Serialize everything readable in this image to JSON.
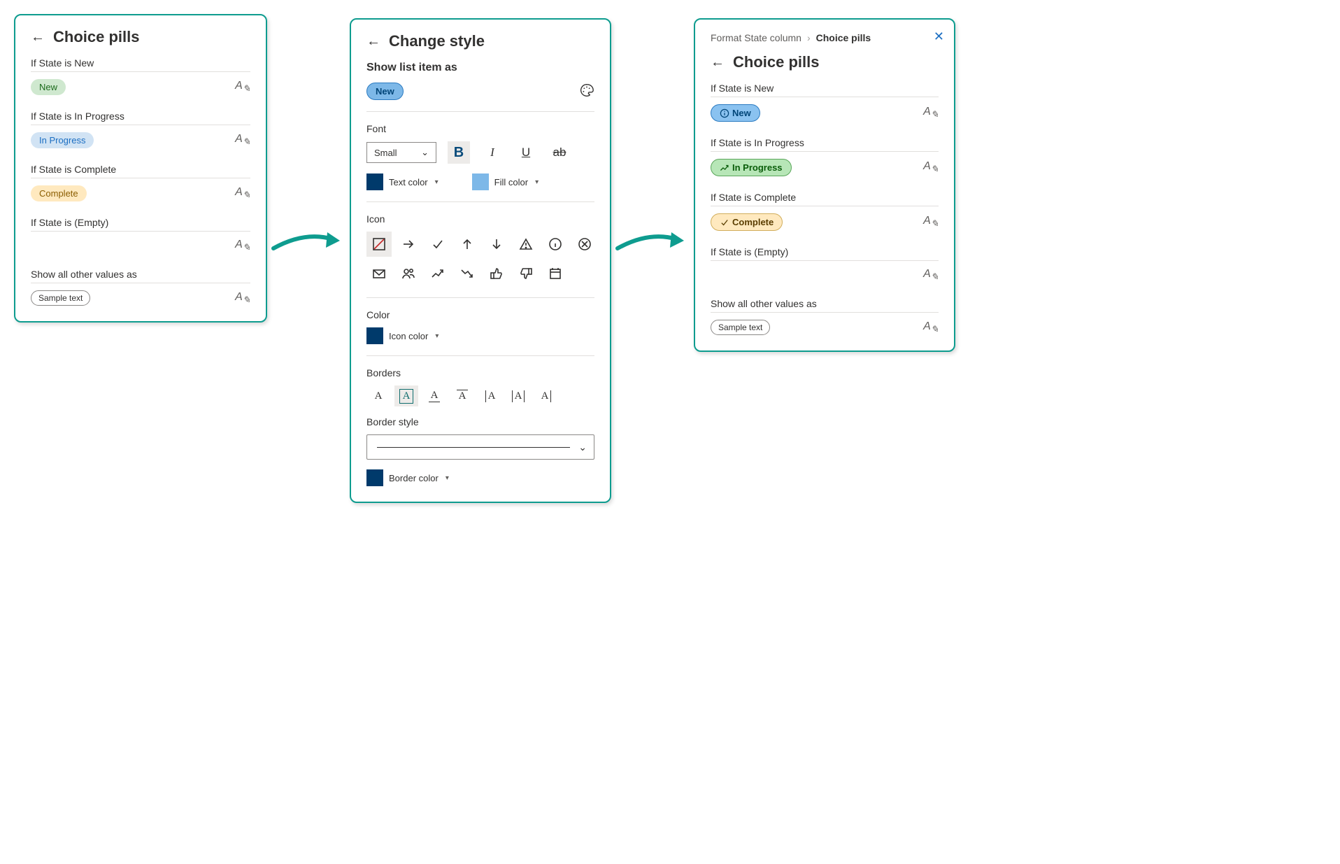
{
  "panel1": {
    "title": "Choice pills",
    "rules": [
      {
        "label": "If State is New",
        "pill": "New",
        "pill_class": "pill-green-light"
      },
      {
        "label": "If State is In Progress",
        "pill": "In Progress",
        "pill_class": "pill-blue-light"
      },
      {
        "label": "If State is Complete",
        "pill": "Complete",
        "pill_class": "pill-yellow"
      },
      {
        "label": "If State is (Empty)",
        "pill": "",
        "pill_class": ""
      }
    ],
    "other_label": "Show all other values as",
    "other_pill": "Sample text"
  },
  "panel2": {
    "title": "Change style",
    "show_as_label": "Show list item as",
    "sample_pill": "New",
    "font": {
      "section": "Font",
      "size": "Small"
    },
    "text_color_label": "Text color",
    "fill_color_label": "Fill color",
    "text_color": "#003a6b",
    "fill_color": "#7db8e8",
    "icon_section": "Icon",
    "color_section": "Color",
    "icon_color_label": "Icon color",
    "icon_color": "#003a6b",
    "borders_section": "Borders",
    "border_style_section": "Border style",
    "border_color_label": "Border color",
    "border_color": "#003a6b",
    "icons": [
      "none",
      "right-arrow",
      "check",
      "up",
      "down",
      "warning",
      "info",
      "cancel",
      "mail",
      "people",
      "trending-up",
      "trending-down",
      "thumbs-up",
      "thumbs-down",
      "calendar"
    ]
  },
  "panel3": {
    "breadcrumb1": "Format State column",
    "breadcrumb2": "Choice pills",
    "title": "Choice pills",
    "rules": [
      {
        "label": "If State is New",
        "pill": "New",
        "pill_class": "pill-blue-solid2",
        "icon": "info"
      },
      {
        "label": "If State is In Progress",
        "pill": "In Progress",
        "pill_class": "pill-green-bright",
        "icon": "trending-up"
      },
      {
        "label": "If State is Complete",
        "pill": "Complete",
        "pill_class": "pill-yellow-bold",
        "icon": "check"
      },
      {
        "label": "If State is (Empty)",
        "pill": "",
        "pill_class": "",
        "icon": ""
      }
    ],
    "other_label": "Show all other values as",
    "other_pill": "Sample text"
  }
}
